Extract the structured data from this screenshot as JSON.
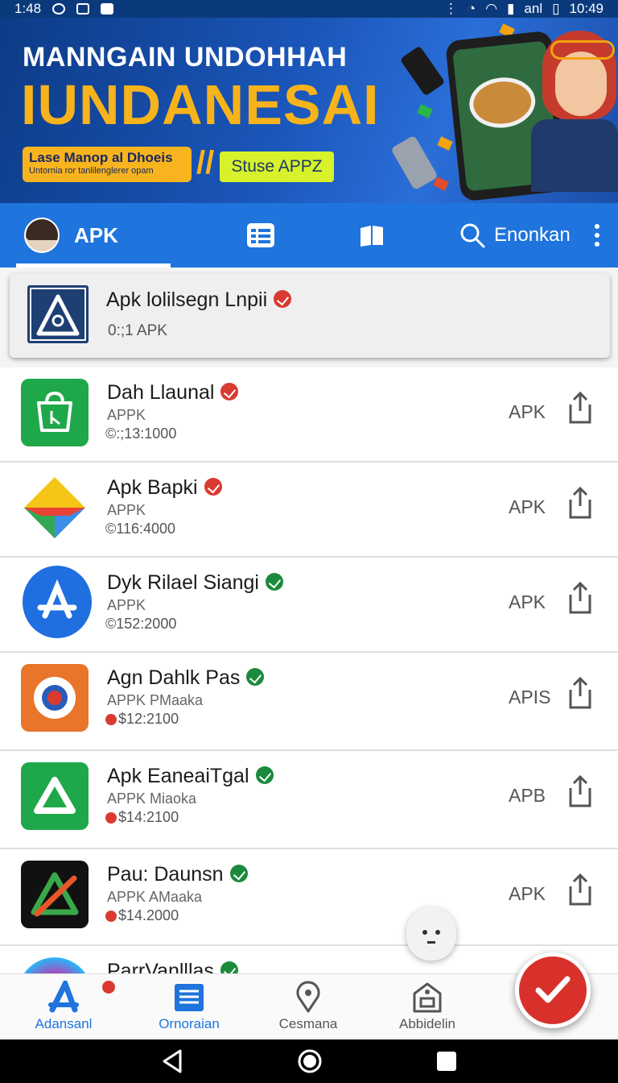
{
  "status_bar": {
    "time_left": "1:48",
    "carrier_text": "anl",
    "time_right": "10:49"
  },
  "banner": {
    "headline": "MANNGAIN UNDOHHAH",
    "title": "IUNDANESAI",
    "pill_line1": "Lase Manop al Dhoeis",
    "pill_line2": "Untornia ror tanlilenglerer opam",
    "cta": "Stuse APPZ"
  },
  "tabs": {
    "active_label": "APK",
    "search_label": "Enonkan"
  },
  "featured": {
    "title": "Apk lolilsegn Lnpii",
    "subtitle": "0:;1 APK"
  },
  "apps": [
    {
      "name": "Dah Llaunal",
      "type": "APPK",
      "size": "©:;13:1000",
      "tag": "APK",
      "badge": "red",
      "size_dot": false
    },
    {
      "name": "Apk Bapki",
      "type": "APPK",
      "size": "©116:4000",
      "tag": "APK",
      "badge": "red",
      "size_dot": false
    },
    {
      "name": "Dyk Rilael Siangi",
      "type": "APPK",
      "size": "©152:2000",
      "tag": "APK",
      "badge": "green",
      "size_dot": false
    },
    {
      "name": "Agn Dahlk Pas",
      "type": "APPK PMaaka",
      "size": "$12:2100",
      "tag": "APIS",
      "badge": "green",
      "size_dot": true
    },
    {
      "name": "Apk EaneaiTgal",
      "type": "APPK Miaoka",
      "size": "$14:2100",
      "tag": "APB",
      "badge": "green",
      "size_dot": true
    },
    {
      "name": "Pau: Daunsn",
      "type": "APPK AMaaka",
      "size": "$14.2000",
      "tag": "APK",
      "badge": "green",
      "size_dot": true
    },
    {
      "name": "ParrVanlllas",
      "type": "",
      "size": "",
      "tag": "",
      "badge": "green",
      "size_dot": false
    }
  ],
  "bottom_nav": [
    {
      "label": "Adansanl"
    },
    {
      "label": "Ornoraian"
    },
    {
      "label": "Cesmana"
    },
    {
      "label": "Abbidelin"
    }
  ],
  "colors": {
    "primary": "#1f74dd",
    "banner_gold": "#f7b31c",
    "fab_red": "#d8312b",
    "badge_green": "#1c8a3c",
    "badge_red": "#d93a31"
  }
}
